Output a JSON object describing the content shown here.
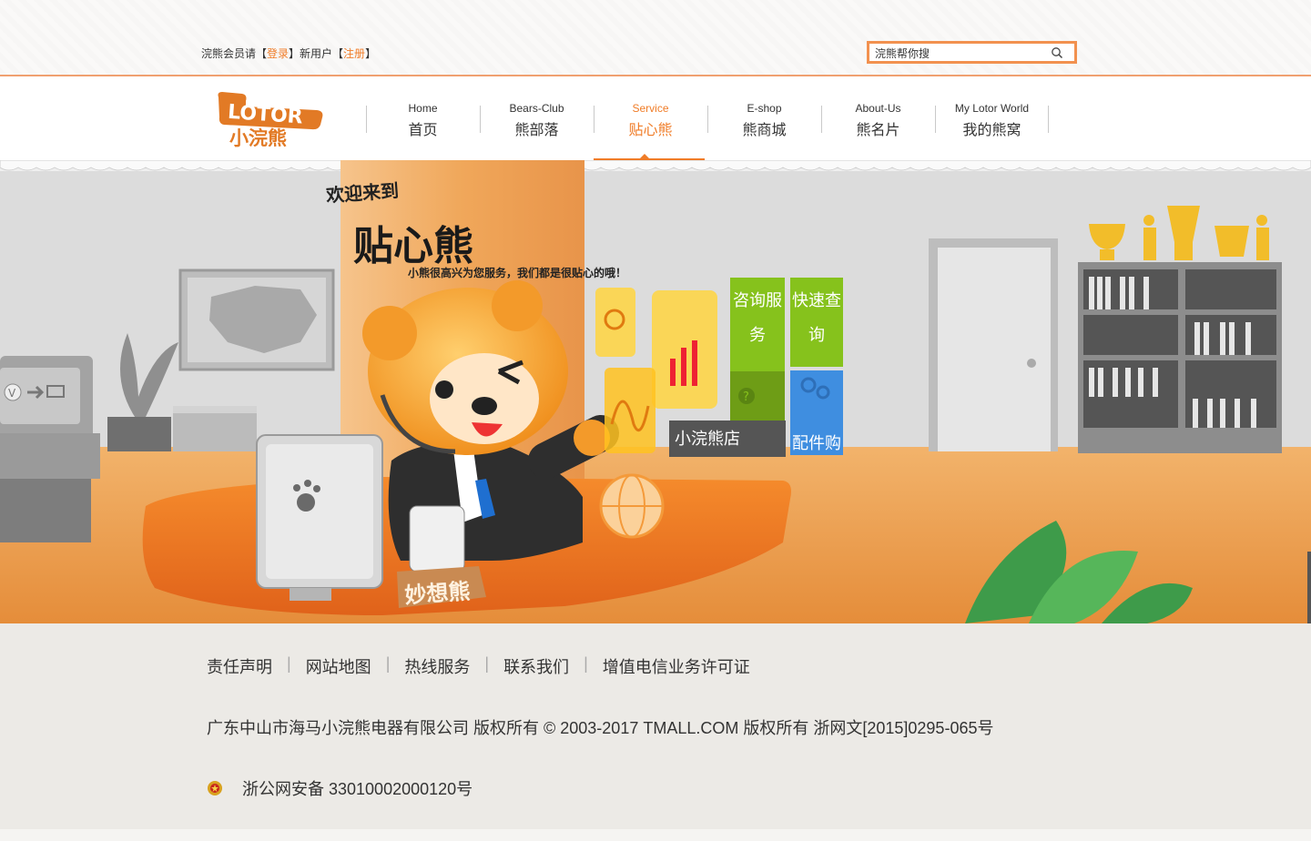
{
  "topbar": {
    "login_prefix": "浣熊会员请【",
    "login_link": "登录",
    "login_middle": "】新用户【",
    "register_link": "注册",
    "login_suffix": "】",
    "search_value": "浣熊帮你搜"
  },
  "logo": {
    "wordmark": "LOTOR",
    "cn": "小浣熊"
  },
  "nav": {
    "items": [
      {
        "en": "Home",
        "cn": "首页"
      },
      {
        "en": "Bears-Club",
        "cn": "熊部落"
      },
      {
        "en": "Service",
        "cn": "贴心熊"
      },
      {
        "en": "E-shop",
        "cn": "熊商城"
      },
      {
        "en": "About-Us",
        "cn": "熊名片"
      },
      {
        "en": "My Lotor World",
        "cn": "我的熊窝"
      }
    ],
    "active_index": 2
  },
  "hero": {
    "welcome": "欢迎来到",
    "brand": "贴心熊",
    "subtitle": "小熊很高兴为您服务，我们都是很贴心的哦！",
    "desk_sign": "妙想熊",
    "tiles": {
      "consult": "咨询服务",
      "query": "快速查询",
      "shop": "小浣熊店",
      "parts": "配件购"
    }
  },
  "footer": {
    "links": [
      "责任声明",
      "网站地图",
      "热线服务",
      "联系我们",
      "增值电信业务许可证"
    ],
    "copyright": "广东中山市海马小浣熊电器有限公司 版权所有  © 2003-2017 TMALL.COM 版权所有  浙网文[2015]0295-065号",
    "police": "浙公网安备 33010002000120号"
  },
  "colors": {
    "accent": "#f07c27",
    "green_tile": "#86c21c",
    "blue_tile": "#3f8ee0"
  }
}
